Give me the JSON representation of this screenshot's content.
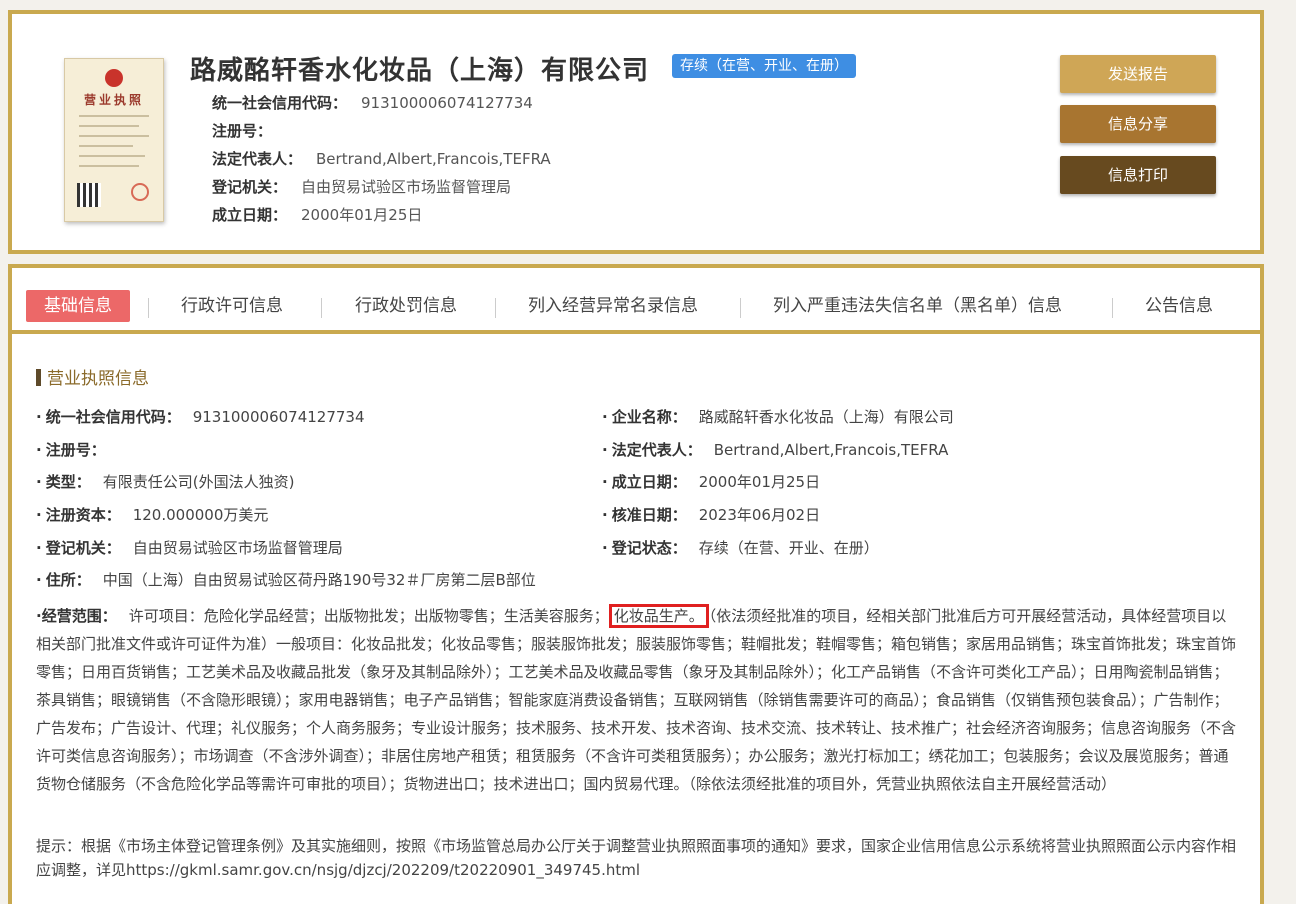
{
  "header": {
    "company_name": "路威酩轩香水化妆品（上海）有限公司",
    "status": "存续（在营、开业、在册）",
    "fields": [
      {
        "label": "统一社会信用代码：",
        "value": "913100006074127734"
      },
      {
        "label": "注册号：",
        "value": ""
      },
      {
        "label": "法定代表人：",
        "value": "Bertrand,Albert,Francois,TEFRA"
      },
      {
        "label": "登记机关：",
        "value": "自由贸易试验区市场监督管理局"
      },
      {
        "label": "成立日期：",
        "value": "2000年01月25日"
      }
    ],
    "buttons": {
      "send": "发送报告",
      "share": "信息分享",
      "print": "信息打印"
    },
    "license_title": "营业执照"
  },
  "tabs": [
    "基础信息",
    "行政许可信息",
    "行政处罚信息",
    "列入经营异常名录信息",
    "列入严重违法失信名单（黑名单）信息",
    "公告信息"
  ],
  "section_title": "营业执照信息",
  "info_left": [
    {
      "label": "统一社会信用代码：",
      "value": "913100006074127734"
    },
    {
      "label": "注册号：",
      "value": ""
    },
    {
      "label": "类型：",
      "value": "有限责任公司(外国法人独资)"
    },
    {
      "label": "注册资本：",
      "value": "120.000000万美元"
    },
    {
      "label": "登记机关：",
      "value": "自由贸易试验区市场监督管理局"
    },
    {
      "label": "住所：",
      "value": "中国（上海）自由贸易试验区荷丹路190号32＃厂房第二层B部位"
    }
  ],
  "info_right": [
    {
      "label": "企业名称：",
      "value": "路威酩轩香水化妆品（上海）有限公司"
    },
    {
      "label": "法定代表人：",
      "value": "Bertrand,Albert,Francois,TEFRA"
    },
    {
      "label": "成立日期：",
      "value": "2000年01月25日"
    },
    {
      "label": "核准日期：",
      "value": "2023年06月02日"
    },
    {
      "label": "登记状态：",
      "value": "存续（在营、开业、在册）"
    }
  ],
  "scope": {
    "label": "经营范围：",
    "before": "许可项目：危险化学品经营；出版物批发；出版物零售；生活美容服务；",
    "highlight": "化妆品生产。",
    "after": "（依法须经批准的项目，经相关部门批准后方可开展经营活动，具体经营项目以相关部门批准文件或许可证件为准）一般项目：化妆品批发；化妆品零售；服装服饰批发；服装服饰零售；鞋帽批发；鞋帽零售；箱包销售；家居用品销售；珠宝首饰批发；珠宝首饰零售；日用百货销售；工艺美术品及收藏品批发（象牙及其制品除外）；工艺美术品及收藏品零售（象牙及其制品除外）；化工产品销售（不含许可类化工产品）；日用陶瓷制品销售；茶具销售；眼镜销售（不含隐形眼镜）；家用电器销售；电子产品销售；智能家庭消费设备销售；互联网销售（除销售需要许可的商品）；食品销售（仅销售预包装食品）；广告制作；广告发布；广告设计、代理；礼仪服务；个人商务服务；专业设计服务；技术服务、技术开发、技术咨询、技术交流、技术转让、技术推广；社会经济咨询服务；信息咨询服务（不含许可类信息咨询服务）；市场调查（不含涉外调查）；非居住房地产租赁；租赁服务（不含许可类租赁服务）；办公服务；激光打标加工；绣花加工；包装服务；会议及展览服务；普通货物仓储服务（不含危险化学品等需许可审批的项目）；货物进出口；技术进出口；国内贸易代理。（除依法须经批准的项目外，凭营业执照依法自主开展经营活动）"
  },
  "notice": "提示：根据《市场主体登记管理条例》及其实施细则，按照《市场监管总局办公厅关于调整营业执照照面事项的通知》要求，国家企业信用信息公示系统将营业执照照面公示内容作相应调整，详见https://gkml.samr.gov.cn/nsjg/djzcj/202209/t20220901_349745.html",
  "colors": {
    "gold": "#c9a94f",
    "active_tab": "#ec6868",
    "badge": "#3e8ee3",
    "highlight_border": "#e02020"
  }
}
